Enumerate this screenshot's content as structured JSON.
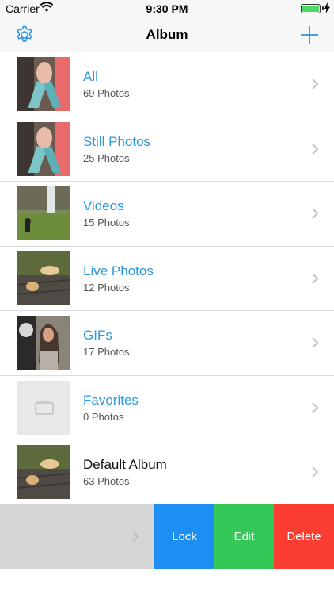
{
  "status_bar": {
    "carrier": "Carrier",
    "time": "9:30 PM",
    "battery_level": 1.0
  },
  "nav": {
    "title": "Album",
    "left_icon": "gear-icon",
    "right_icon": "plus-icon",
    "accent": "#2a98e0"
  },
  "albums": [
    {
      "name": "All",
      "count": "69 Photos",
      "thumb": "woman-outdoor-photo"
    },
    {
      "name": "Still Photos",
      "count": "25 Photos",
      "thumb": "woman-outdoor-photo"
    },
    {
      "name": "Videos",
      "count": "15 Photos",
      "thumb": "waterfall-landscape-photo"
    },
    {
      "name": "Live Photos",
      "count": "12 Photos",
      "thumb": "dog-on-deck-photo"
    },
    {
      "name": "GIFs",
      "count": "17 Photos",
      "thumb": "woman-portrait-photo"
    },
    {
      "name": "Favorites",
      "count": "0 Photos",
      "thumb": "empty-album-icon"
    },
    {
      "name": "Default Album",
      "count": "63 Photos",
      "thumb": "dog-on-deck-photo"
    }
  ],
  "swipe_actions": {
    "lock": "Lock",
    "edit": "Edit",
    "delete": "Delete",
    "colors": {
      "lock": "#1d8ff2",
      "edit": "#35c859",
      "delete": "#fc3d31"
    }
  }
}
